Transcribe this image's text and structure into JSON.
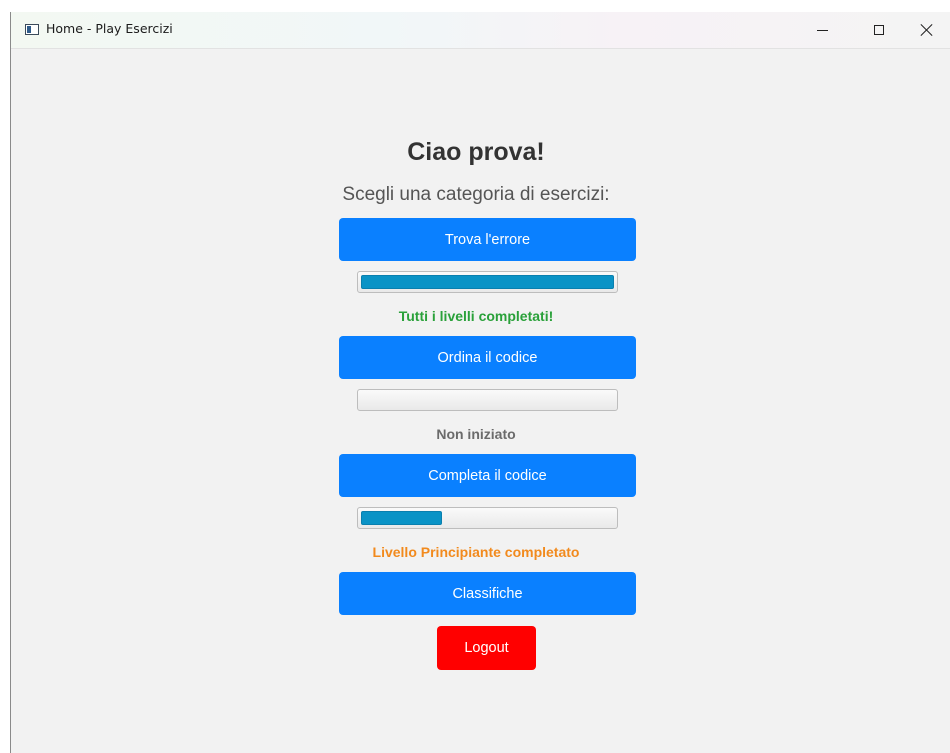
{
  "window": {
    "title": "Home - Play Esercizi",
    "controls": {
      "minimize": "minimize-icon",
      "maximize": "maximize-icon",
      "close": "close-icon"
    }
  },
  "header": {
    "greeting": "Ciao prova!",
    "subtitle": "Scegli una categoria di esercizi:"
  },
  "categories": [
    {
      "label": "Trova l'errore",
      "progress": 1.0,
      "status": "Tutti i livelli completati!",
      "status_color": "#2aa13a"
    },
    {
      "label": "Ordina il codice",
      "progress": 0.0,
      "status": "Non iniziato",
      "status_color": "#6b6b6b"
    },
    {
      "label": "Completa il codice",
      "progress": 0.32,
      "status": "Livello Principiante completato",
      "status_color": "#f28a1d"
    }
  ],
  "actions": {
    "rankings_label": "Classifiche",
    "logout_label": "Logout"
  },
  "colors": {
    "primary_button": "#0a80ff",
    "logout_button": "#ff0000",
    "progress_fill": "#0a93c6"
  }
}
